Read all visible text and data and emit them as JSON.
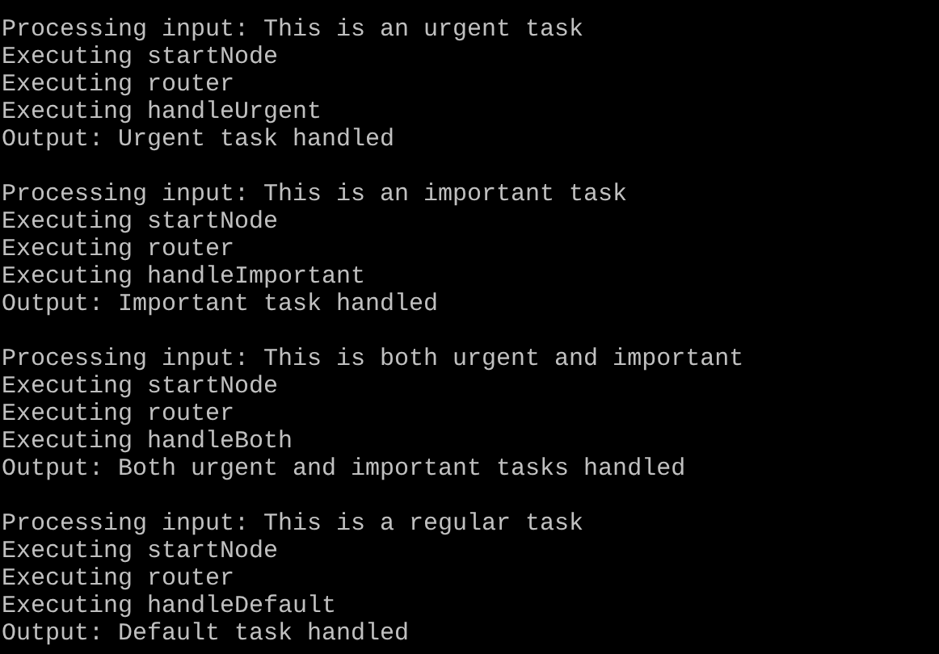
{
  "terminal": {
    "blocks": [
      {
        "lines": [
          "Processing input: This is an urgent task",
          "Executing startNode",
          "Executing router",
          "Executing handleUrgent",
          "Output: Urgent task handled"
        ]
      },
      {
        "lines": [
          "Processing input: This is an important task",
          "Executing startNode",
          "Executing router",
          "Executing handleImportant",
          "Output: Important task handled"
        ]
      },
      {
        "lines": [
          "Processing input: This is both urgent and important",
          "Executing startNode",
          "Executing router",
          "Executing handleBoth",
          "Output: Both urgent and important tasks handled"
        ]
      },
      {
        "lines": [
          "Processing input: This is a regular task",
          "Executing startNode",
          "Executing router",
          "Executing handleDefault",
          "Output: Default task handled"
        ]
      }
    ]
  }
}
